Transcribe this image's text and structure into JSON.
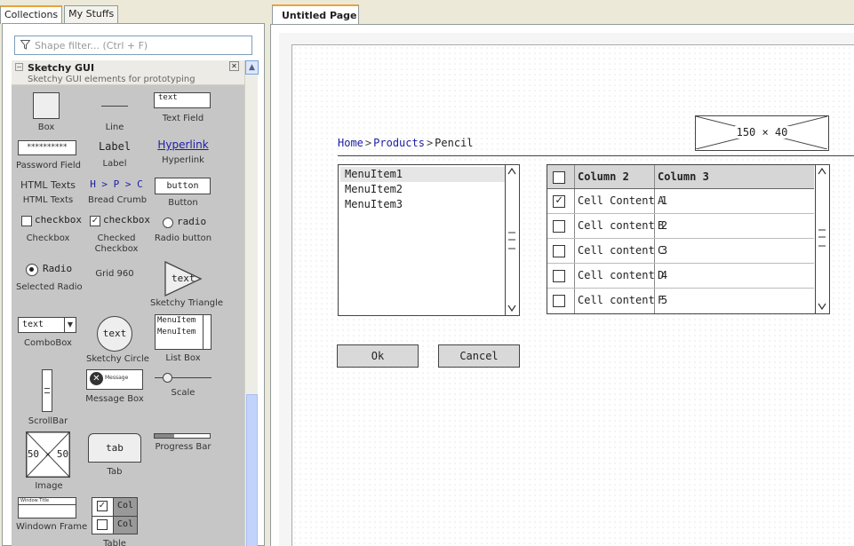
{
  "left_tabs": [
    "Collections",
    "My Stuffs"
  ],
  "filter": {
    "placeholder": "Shape filter... (Ctrl + F)"
  },
  "collection": {
    "title": "Sketchy GUI",
    "subtitle": "Sketchy GUI elements for prototyping",
    "shapes": {
      "box": "Box",
      "line": "Line",
      "text_field": "Text Field",
      "text_field_value": "text",
      "password_field": "Password Field",
      "password_value": "**********",
      "label": "Label",
      "label_glyph": "Label",
      "hyperlink": "Hyperlink",
      "hyperlink_glyph": "Hyperlink",
      "html_texts": "HTML Texts",
      "html_texts_glyph": "HTML Texts",
      "bread_crumb": "Bread Crumb",
      "bread_crumb_glyph": "H > P > C",
      "button": "Button",
      "button_glyph": "button",
      "checkbox": "Checkbox",
      "checkbox_glyph": "checkbox",
      "checked_checkbox": "Checked Checkbox",
      "checked_checkbox_glyph": "checkbox",
      "radio_button": "Radio button",
      "radio_glyph": "radio",
      "selected_radio": "Selected Radio",
      "selected_radio_glyph": "Radio",
      "grid_960": "Grid 960",
      "sketchy_triangle": "Sketchy Triangle",
      "triangle_glyph": "text",
      "combobox": "ComboBox",
      "combobox_glyph": "text",
      "sketchy_circle": "Sketchy Circle",
      "circle_glyph": "text",
      "list_box": "List Box",
      "list_box_glyph1": "MenuItem",
      "list_box_glyph2": "MenuItem",
      "scrollbar": "ScrollBar",
      "message_box": "Message Box",
      "message_box_glyph": "Message",
      "scale": "Scale",
      "image": "Image",
      "image_glyph": "50 × 50",
      "tab": "Tab",
      "tab_glyph": "tab",
      "progress_bar": "Progress Bar",
      "window_frame": "Windown Frame",
      "window_frame_glyph": "Window Title",
      "table": "Table",
      "table_glyph": "Col"
    }
  },
  "page_tab": "Untitled Page",
  "canvas": {
    "image_placeholder": "150 × 40",
    "breadcrumb": {
      "home": "Home",
      "products": "Products",
      "current": "Pencil",
      "sep": ">"
    },
    "listbox": [
      "MenuItem1",
      "MenuItem2",
      "MenuItem3"
    ],
    "ok_label": "Ok",
    "cancel_label": "Cancel",
    "grid": {
      "headers": [
        "Column 2",
        "Column 3"
      ],
      "rows": [
        {
          "checked": true,
          "col2": "Cell Content 1",
          "col3": "A"
        },
        {
          "checked": false,
          "col2": "Cell content 2",
          "col3": "B"
        },
        {
          "checked": false,
          "col2": "Cell content 3",
          "col3": "C"
        },
        {
          "checked": false,
          "col2": "Cell content 4",
          "col3": "D"
        },
        {
          "checked": false,
          "col2": "Cell content 5",
          "col3": "F"
        }
      ]
    }
  },
  "colors": {
    "accent_tab": "#e8a33a",
    "hyperlink": "#1c1ca8",
    "panel_bg": "#c6c6c6"
  }
}
